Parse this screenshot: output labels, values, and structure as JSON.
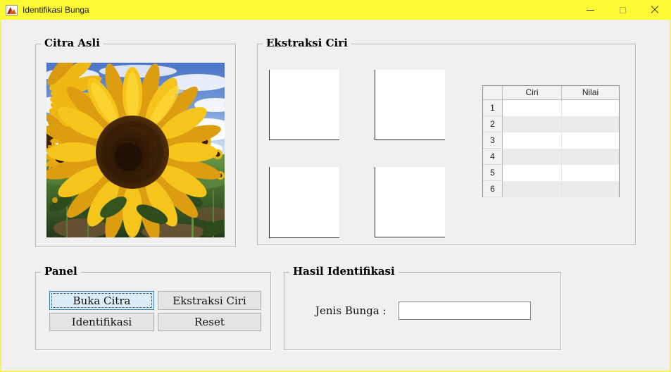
{
  "titlebar": {
    "title": "Identifikasi Bunga",
    "app_icon": "matlab-logo-icon",
    "controls": {
      "minimize": "minimize-icon",
      "maximize": "maximize-icon-disabled",
      "close": "close-icon"
    }
  },
  "panels": {
    "citra": {
      "title": "Citra Asli",
      "image": "sunflower-field-photo"
    },
    "ekstraksi": {
      "title": "Ekstraksi Ciri",
      "axes_count": 4
    },
    "panel": {
      "title": "Panel",
      "buttons": [
        {
          "label": "Buka Citra",
          "focused": true
        },
        {
          "label": "Ekstraksi Ciri",
          "focused": false
        },
        {
          "label": "Identifikasi",
          "focused": false
        },
        {
          "label": "Reset",
          "focused": false
        }
      ]
    },
    "hasil": {
      "title": "Hasil Identifikasi",
      "label": "Jenis Bunga :",
      "field_value": ""
    }
  },
  "table": {
    "columns": [
      "Ciri",
      "Nilai"
    ],
    "rows": [
      {
        "num": "1",
        "ciri": "",
        "nilai": ""
      },
      {
        "num": "2",
        "ciri": "",
        "nilai": ""
      },
      {
        "num": "3",
        "ciri": "",
        "nilai": ""
      },
      {
        "num": "4",
        "ciri": "",
        "nilai": ""
      },
      {
        "num": "5",
        "ciri": "",
        "nilai": ""
      },
      {
        "num": "6",
        "ciri": "",
        "nilai": ""
      }
    ]
  },
  "colors": {
    "titlebar_bg": "#fdf935",
    "window_border": "#f7f462",
    "background": "#f0f0f0",
    "focus_button_border": "#3c7fb1",
    "focus_button_bg": "#dcecf9"
  }
}
